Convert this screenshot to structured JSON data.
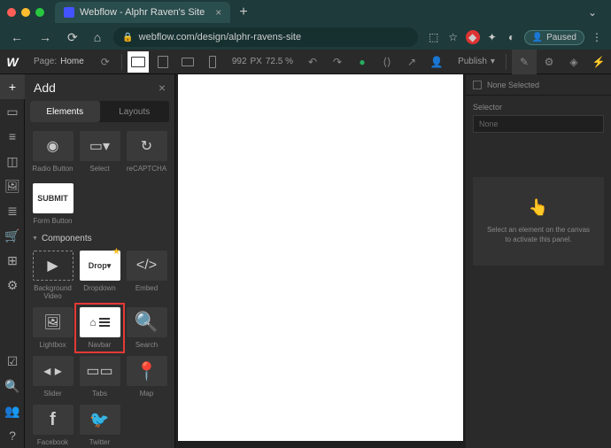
{
  "browser": {
    "tab_title": "Webflow - Alphr Raven's Site",
    "url": "webflow.com/design/alphr-ravens-site",
    "paused_label": "Paused"
  },
  "toolbar": {
    "page_label": "Page:",
    "page_value": "Home",
    "width_px": "992",
    "px_label": "PX",
    "zoom": "72.5 %",
    "publish": "Publish"
  },
  "add_panel": {
    "title": "Add",
    "tabs": {
      "elements": "Elements",
      "layouts": "Layouts"
    },
    "row1": [
      "Radio Button",
      "Select",
      "reCAPTCHA"
    ],
    "submit_button": "SUBMIT",
    "submit_label": "Form Button",
    "components_header": "Components",
    "components": {
      "bg_video": "Background Video",
      "dropdown": "Dropdown",
      "dropdown_thumb": "Drop",
      "embed": "Embed",
      "lightbox": "Lightbox",
      "navbar": "Navbar",
      "search": "Search",
      "slider": "Slider",
      "tabs": "Tabs",
      "map": "Map",
      "facebook": "Facebook",
      "twitter": "Twitter"
    }
  },
  "right_panel": {
    "none_selected": "None Selected",
    "selector_label": "Selector",
    "selector_placeholder": "None",
    "empty_line1": "Select an element on the canvas",
    "empty_line2": "to activate this panel."
  }
}
